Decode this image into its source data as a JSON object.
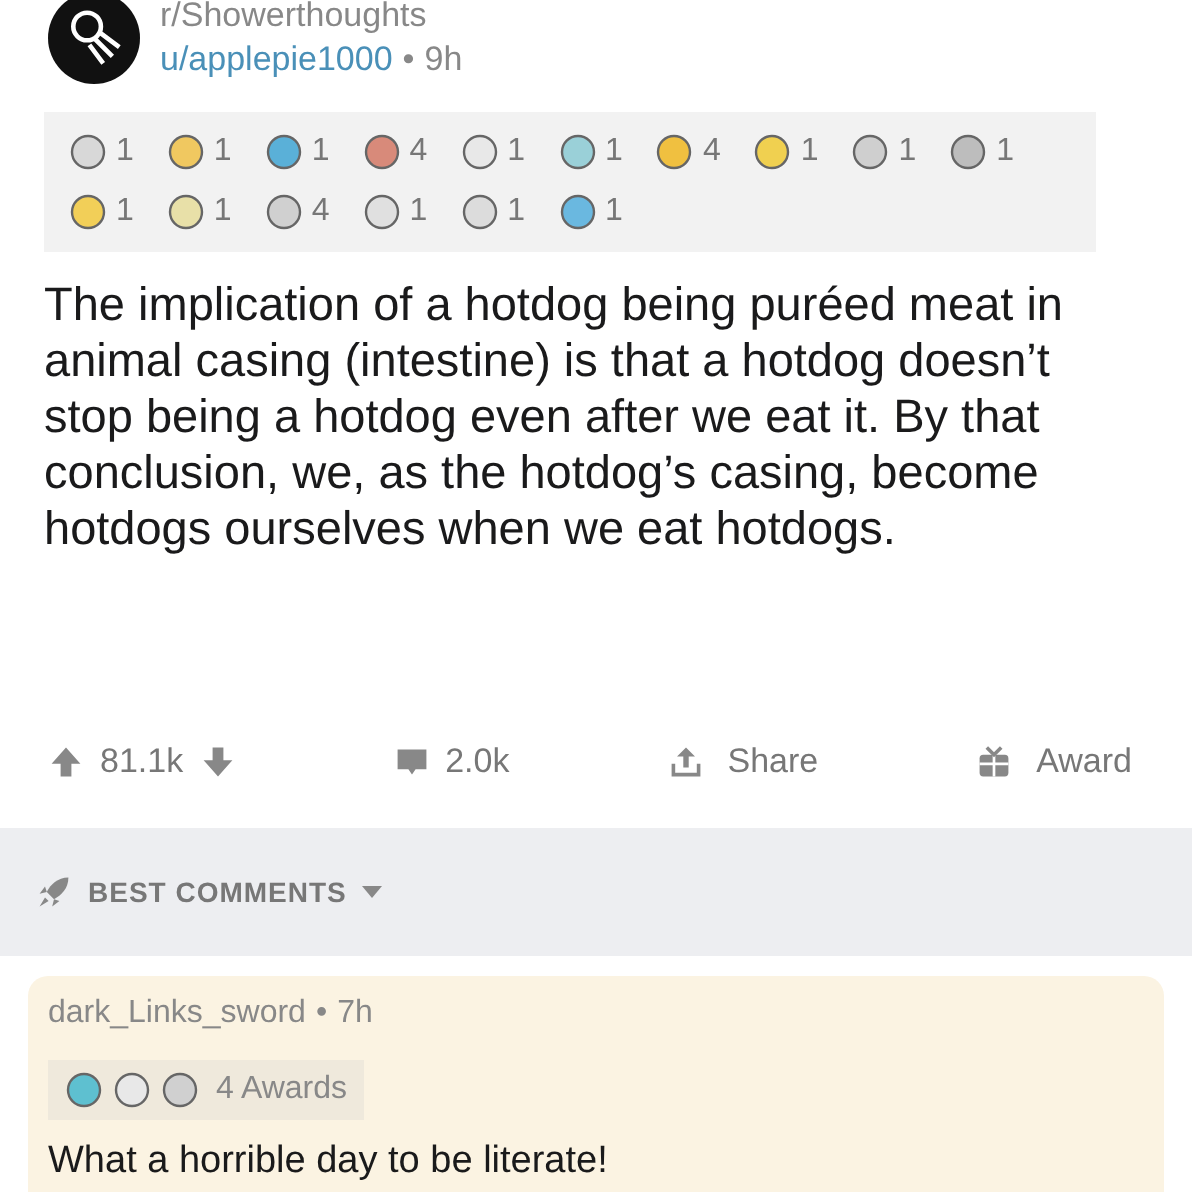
{
  "post": {
    "subreddit": "r/Showerthoughts",
    "author": "u/applepie1000",
    "separator": "•",
    "time": "9h",
    "awards": [
      {
        "count": "1",
        "color": "#d8d8d8"
      },
      {
        "count": "1",
        "color": "#f0c860"
      },
      {
        "count": "1",
        "color": "#5ab0d8"
      },
      {
        "count": "4",
        "color": "#d88a7a"
      },
      {
        "count": "1",
        "color": "#e8e8e8"
      },
      {
        "count": "1",
        "color": "#9ad0d8"
      },
      {
        "count": "4",
        "color": "#f0c040"
      },
      {
        "count": "1",
        "color": "#f0d050"
      },
      {
        "count": "1",
        "color": "#cfcfcf"
      },
      {
        "count": "1",
        "color": "#bdbdbd"
      },
      {
        "count": "1",
        "color": "#f2cf58"
      },
      {
        "count": "1",
        "color": "#e8e0a8"
      },
      {
        "count": "4",
        "color": "#d0d0d0"
      },
      {
        "count": "1",
        "color": "#e0e0e0"
      },
      {
        "count": "1",
        "color": "#dcdcdc"
      },
      {
        "count": "1",
        "color": "#6ab8e0"
      }
    ],
    "body": "The implication of a hotdog being puréed meat in animal casing (intestine) is that a hotdog doesn’t stop being a hotdog even after we eat it. By that conclusion, we, as the hotdog’s casing, become hotdogs ourselves when we eat hotdogs.",
    "score": "81.1k",
    "comments": "2.0k",
    "share": "Share",
    "award": "Award"
  },
  "sort": {
    "label": "BEST COMMENTS"
  },
  "comment": {
    "author": "dark_Links_sword",
    "separator": "•",
    "time": "7h",
    "awards": [
      {
        "color": "#5ec0d0"
      },
      {
        "color": "#e8e8e8"
      },
      {
        "color": "#d0d0d0"
      }
    ],
    "awards_label": "4 Awards",
    "body": "What a horrible day to be  literate!"
  }
}
